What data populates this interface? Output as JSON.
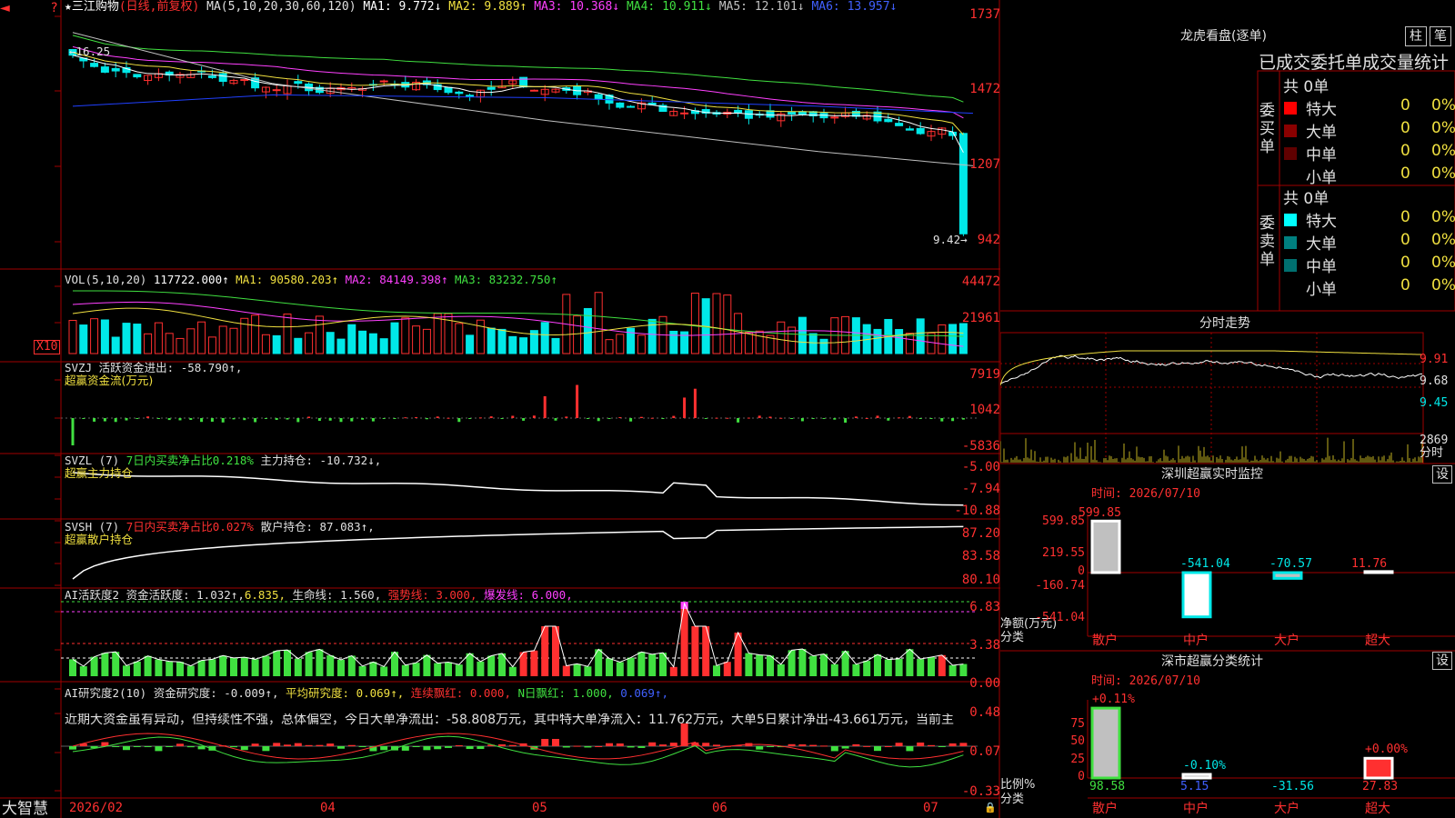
{
  "colors": {
    "up": "#ff3030",
    "down": "#00e8e8",
    "ma1": "#ffffff",
    "ma2": "#f0e040",
    "ma3": "#ff40ff",
    "ma4": "#40e040",
    "ma5": "#c0c0c0",
    "ma6": "#2040ff",
    "grid": "#a00000"
  },
  "header": {
    "star": "★",
    "stock": "三江购物",
    "mode": "(日线,前复权)",
    "ma_params": "MA(5,10,20,30,60,120)",
    "ma1": "MA1: 9.772↓",
    "ma2": "MA2: 9.889↑",
    "ma3": "MA3: 10.368↓",
    "ma4": "MA4: 10.911↓",
    "ma5": "MA5: 12.101↓",
    "ma6": "MA6: 13.957↓"
  },
  "price_axis": [
    "1737",
    "1472",
    "1207",
    "942"
  ],
  "price_annot": {
    "high": "16.25",
    "low": "9.42"
  },
  "volume": {
    "title": "VOL(5,10,20)",
    "value": "117722.000↑",
    "ma1": "MA1: 90580.203↑",
    "ma2": "MA2: 84149.398↑",
    "ma3": "MA3: 83232.750↑",
    "axis": [
      "44472",
      "21961"
    ],
    "unit": "X10"
  },
  "svzj": {
    "line1_a": "SVZJ",
    "line1_b": "活跃资金进出: -58.790↑,",
    "line2": "超赢资金流(万元)",
    "axis": [
      "7919",
      "1042",
      "-5836"
    ]
  },
  "svzl": {
    "name": "SVZL (7)",
    "ratio": "7日内买卖净占比0.218%",
    "hold": "主力持仓: -10.732↓,",
    "line2": "超赢主力持仓",
    "axis": [
      "-5.00",
      "-7.94",
      "-10.88"
    ]
  },
  "svsh": {
    "name": "SVSH (7)",
    "ratio": "7日内买卖净占比0.027%",
    "hold": "散户持仓: 87.083↑,",
    "line2": "超赢散户持仓",
    "axis": [
      "87.20",
      "83.58",
      "80.10"
    ]
  },
  "ai_active": {
    "name": "AI活跃度2",
    "a": "资金活跃度: 1.032↑,",
    "b": "6.835,",
    "c": "生命线: 1.560,",
    "d": "强势线: 3.000,",
    "e": "爆发线: 6.000,",
    "axis": [
      "6.83",
      "3.38",
      "0.00"
    ]
  },
  "ai_research": {
    "name": "AI研究度2(10)",
    "a": "资金研究度: -0.009↑,",
    "b": "平均研究度: 0.069↑,",
    "c": "连续飘红: 0.000,",
    "d": "N日飘红: 1.000,",
    "e": "0.069↑,",
    "text": "近期大资金虽有异动，但持续性不强，总体偏空，今日大单净流出：-58.808万元，其中特大单净流入：11.762万元，大单5日累计净出-43.661万元，当前主",
    "axis": [
      "0.48",
      "0.07",
      "-0.33"
    ]
  },
  "bottom": {
    "brand": "大智慧",
    "dates": [
      "2026/02",
      "04",
      "05",
      "06",
      "07"
    ]
  },
  "longhu": {
    "title": "龙虎看盘(逐单)",
    "btn1": "柱",
    "btn2": "笔",
    "header": "已成交委托单成交量统计",
    "buy_side": "委买单",
    "sell_side": "委卖单",
    "buy_total": "共 0单",
    "sell_total": "共 0单",
    "buy_rows": [
      {
        "name": "特大",
        "num": "0",
        "pct": "0%",
        "color": "#ff0000"
      },
      {
        "name": "大单",
        "num": "0",
        "pct": "0%",
        "color": "#8a0000"
      },
      {
        "name": "中单",
        "num": "0",
        "pct": "0%",
        "color": "#600000"
      },
      {
        "name": "小单",
        "num": "0",
        "pct": "0%",
        "color": ""
      }
    ],
    "sell_rows": [
      {
        "name": "特大",
        "num": "0",
        "pct": "0%",
        "color": "#00ffff"
      },
      {
        "name": "大单",
        "num": "0",
        "pct": "0%",
        "color": "#008080"
      },
      {
        "name": "中单",
        "num": "0",
        "pct": "0%",
        "color": "#007070"
      },
      {
        "name": "小单",
        "num": "0",
        "pct": "0%",
        "color": ""
      }
    ]
  },
  "intraday": {
    "title": "分时走势",
    "axis": [
      "9.91",
      "9.68",
      "9.45"
    ],
    "vol": "2869",
    "vol_unit": "分时"
  },
  "sz_monitor": {
    "title": "深圳超赢实时监控",
    "btn": "设",
    "time": "时间: 2026/07/10",
    "axis": [
      "599.85",
      "219.55",
      "0",
      "-160.74",
      "-541.04"
    ],
    "ylab1": "净额(万元)",
    "ylab2": "分类",
    "bars": [
      {
        "cat": "散户",
        "value": 599.85,
        "label": "599.85"
      },
      {
        "cat": "中户",
        "value": -541.04,
        "label": "-541.04"
      },
      {
        "cat": "大户",
        "value": -70.57,
        "label": "-70.57"
      },
      {
        "cat": "超大",
        "value": 11.76,
        "label": "11.76"
      }
    ]
  },
  "sz_stats": {
    "title": "深市超赢分类统计",
    "btn": "设",
    "time": "时间: 2026/07/10",
    "axis": [
      "75",
      "50",
      "25",
      "0"
    ],
    "ylab1": "比例%",
    "ylab2": "分类",
    "bars": [
      {
        "cat": "散户",
        "value": 98.58,
        "top": "+0.11%",
        "bottom": "98.58"
      },
      {
        "cat": "中户",
        "value": 5.15,
        "top": "-0.10%",
        "bottom": "5.15"
      },
      {
        "cat": "大户",
        "value": -31.56,
        "top": "",
        "bottom": "-31.56"
      },
      {
        "cat": "超大",
        "value": 27.83,
        "top": "+0.00%",
        "bottom": "27.83"
      }
    ]
  }
}
